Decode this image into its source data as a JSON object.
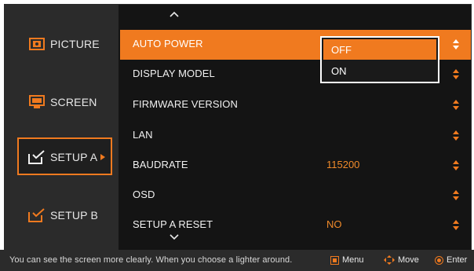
{
  "sidebar": {
    "items": [
      {
        "label": "PICTURE",
        "icon": "picture-icon"
      },
      {
        "label": "SCREEN",
        "icon": "screen-icon"
      },
      {
        "label": "SETUP A",
        "icon": "setup-icon",
        "active": true
      },
      {
        "label": "SETUP B",
        "icon": "setup-icon"
      }
    ]
  },
  "menu": {
    "up_indicator": "^",
    "down_indicator": "v",
    "rows": [
      {
        "label": "AUTO POWER",
        "value": "",
        "selected": true
      },
      {
        "label": "DISPLAY MODEL",
        "value": ""
      },
      {
        "label": "FIRMWARE VERSION",
        "value": ""
      },
      {
        "label": "LAN",
        "value": ""
      },
      {
        "label": "BAUDRATE",
        "value": "115200"
      },
      {
        "label": "OSD",
        "value": ""
      },
      {
        "label": "SETUP A RESET",
        "value": "NO"
      }
    ]
  },
  "dropdown": {
    "options": [
      "OFF",
      "ON"
    ],
    "selected": "OFF"
  },
  "statusbar": {
    "hint": "You can see the screen more clearly.  When you choose a lighter around.",
    "menu_label": "Menu",
    "move_label": "Move",
    "enter_label": "Enter"
  },
  "colors": {
    "accent": "#f07a1f",
    "background": "#141414",
    "sidebar": "#2b2b2b"
  }
}
